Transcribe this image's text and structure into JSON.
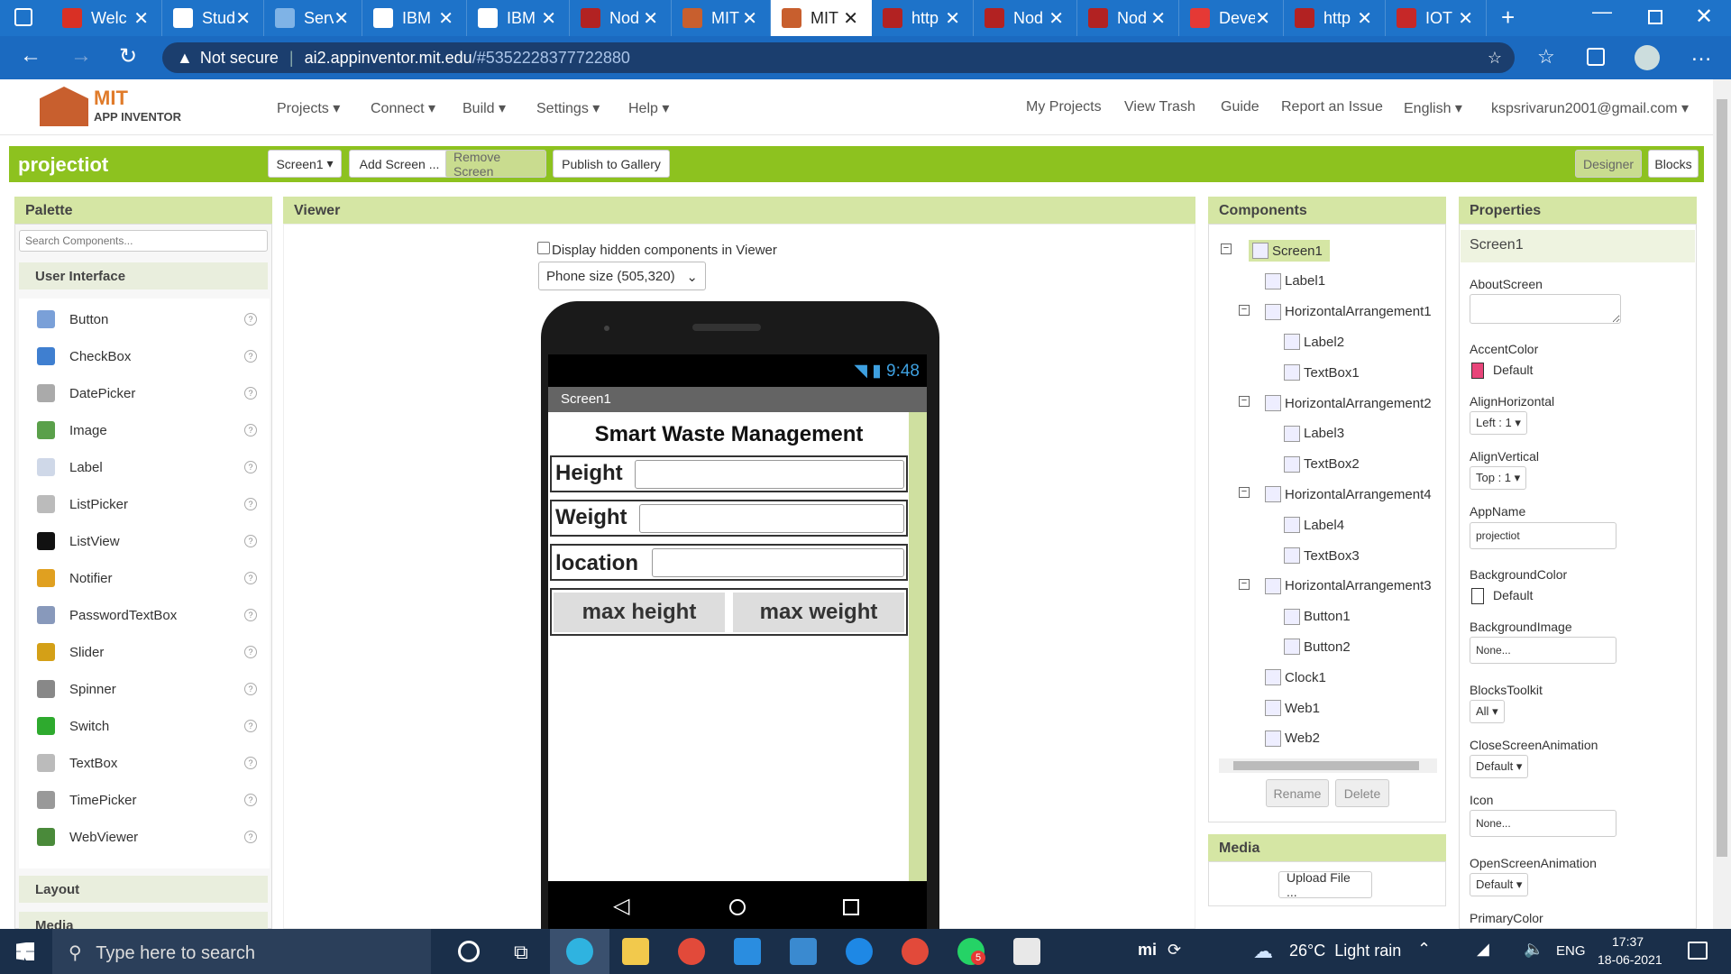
{
  "browser": {
    "tabs": [
      {
        "label": "Welc",
        "color": "#d93025"
      },
      {
        "label": "Stud",
        "color": "#ffffff"
      },
      {
        "label": "Serv",
        "color": "#7fb3e6"
      },
      {
        "label": "IBM",
        "color": "#ffffff"
      },
      {
        "label": "IBM",
        "color": "#ffffff"
      },
      {
        "label": "Nod",
        "color": "#b22222"
      },
      {
        "label": "MIT",
        "color": "#c85f2e"
      },
      {
        "label": "MIT",
        "color": "#c85f2e"
      },
      {
        "label": "http",
        "color": "#b22222"
      },
      {
        "label": "Nod",
        "color": "#b22222"
      },
      {
        "label": "Nod",
        "color": "#b22222"
      },
      {
        "label": "Deve",
        "color": "#e53935"
      },
      {
        "label": "http",
        "color": "#b22222"
      },
      {
        "label": "IOT",
        "color": "#c62828"
      }
    ],
    "active_tab_index": 7,
    "security_label": "Not secure",
    "url_host": "ai2.appinventor.mit.edu",
    "url_path": "/#5352228377722880"
  },
  "app": {
    "logo_line1": "MIT",
    "logo_line2": "APP INVENTOR",
    "menu": [
      "Projects",
      "Connect",
      "Build",
      "Settings",
      "Help"
    ],
    "right_links": [
      "My Projects",
      "View Trash",
      "Guide",
      "Report an Issue"
    ],
    "language": "English",
    "account": "kspsrivarun2001@gmail.com",
    "project_name": "projectiot",
    "screen_select": "Screen1",
    "add_screen": "Add Screen ...",
    "remove_screen": "Remove Screen",
    "publish": "Publish to Gallery",
    "designer": "Designer",
    "blocks": "Blocks"
  },
  "palette": {
    "title": "Palette",
    "search_placeholder": "Search Components...",
    "category": "User Interface",
    "items": [
      {
        "label": "Button",
        "icon": "button-icon",
        "color": "#7aa0d8"
      },
      {
        "label": "CheckBox",
        "icon": "checkbox-icon",
        "color": "#3f7fd0"
      },
      {
        "label": "DatePicker",
        "icon": "calendar-icon",
        "color": "#aaaaaa"
      },
      {
        "label": "Image",
        "icon": "image-icon",
        "color": "#5aa04a"
      },
      {
        "label": "Label",
        "icon": "label-icon",
        "color": "#cfd8e8"
      },
      {
        "label": "ListPicker",
        "icon": "listpicker-icon",
        "color": "#bbbbbb"
      },
      {
        "label": "ListView",
        "icon": "listview-icon",
        "color": "#111111"
      },
      {
        "label": "Notifier",
        "icon": "warning-icon",
        "color": "#e0a020"
      },
      {
        "label": "PasswordTextBox",
        "icon": "password-icon",
        "color": "#8899bb"
      },
      {
        "label": "Slider",
        "icon": "slider-icon",
        "color": "#d4a017"
      },
      {
        "label": "Spinner",
        "icon": "spinner-icon",
        "color": "#888888"
      },
      {
        "label": "Switch",
        "icon": "switch-icon",
        "color": "#2eaa2e"
      },
      {
        "label": "TextBox",
        "icon": "textbox-icon",
        "color": "#bbbbbb"
      },
      {
        "label": "TimePicker",
        "icon": "clock-icon",
        "color": "#999999"
      },
      {
        "label": "WebViewer",
        "icon": "globe-icon",
        "color": "#4a8a3a"
      }
    ],
    "help_glyph": "?",
    "layout_label": "Layout",
    "media_label": "Media"
  },
  "viewer": {
    "title": "Viewer",
    "hidden_checkbox_label": "Display hidden components in Viewer",
    "phone_size": "Phone size (505,320)",
    "status_time": "9:48",
    "screen_title": "Screen1",
    "app_title": "Smart Waste Management",
    "rows": [
      {
        "label": "Height"
      },
      {
        "label": "Weight"
      },
      {
        "label": "location"
      }
    ],
    "button1": "max height",
    "button2": "max weight"
  },
  "components": {
    "title": "Components",
    "tree": [
      {
        "label": "Screen1",
        "level": 0,
        "toggle": true,
        "selected": true
      },
      {
        "label": "Label1",
        "level": 1,
        "toggle": false
      },
      {
        "label": "HorizontalArrangement1",
        "level": 1,
        "toggle": true
      },
      {
        "label": "Label2",
        "level": 2,
        "toggle": false
      },
      {
        "label": "TextBox1",
        "level": 2,
        "toggle": false
      },
      {
        "label": "HorizontalArrangement2",
        "level": 1,
        "toggle": true
      },
      {
        "label": "Label3",
        "level": 2,
        "toggle": false
      },
      {
        "label": "TextBox2",
        "level": 2,
        "toggle": false
      },
      {
        "label": "HorizontalArrangement4",
        "level": 1,
        "toggle": true
      },
      {
        "label": "Label4",
        "level": 2,
        "toggle": false
      },
      {
        "label": "TextBox3",
        "level": 2,
        "toggle": false
      },
      {
        "label": "HorizontalArrangement3",
        "level": 1,
        "toggle": true
      },
      {
        "label": "Button1",
        "level": 2,
        "toggle": false
      },
      {
        "label": "Button2",
        "level": 2,
        "toggle": false
      },
      {
        "label": "Clock1",
        "level": 1,
        "toggle": false
      },
      {
        "label": "Web1",
        "level": 1,
        "toggle": false
      },
      {
        "label": "Web2",
        "level": 1,
        "toggle": false
      }
    ],
    "rename": "Rename",
    "delete": "Delete"
  },
  "media": {
    "title": "Media",
    "upload": "Upload File ..."
  },
  "properties": {
    "title": "Properties",
    "component": "Screen1",
    "about_label": "AboutScreen",
    "accent_label": "AccentColor",
    "accent_value": "Default",
    "accent_color": "#e8457a",
    "alignh_label": "AlignHorizontal",
    "alignh_value": "Left : 1",
    "alignv_label": "AlignVertical",
    "alignv_value": "Top : 1",
    "appname_label": "AppName",
    "appname_value": "projectiot",
    "bgcolor_label": "BackgroundColor",
    "bgcolor_value": "Default",
    "bgimage_label": "BackgroundImage",
    "bgimage_value": "None...",
    "blocks_label": "BlocksToolkit",
    "blocks_value": "All",
    "close_label": "CloseScreenAnimation",
    "close_value": "Default",
    "icon_label": "Icon",
    "icon_value": "None...",
    "open_label": "OpenScreenAnimation",
    "open_value": "Default",
    "primary_label": "PrimaryColor"
  },
  "taskbar": {
    "search_placeholder": "Type here to search",
    "weather": "26°C  Light rain",
    "lang": "ENG",
    "time": "17:37",
    "date": "18-06-2021",
    "whatsapp_badge": "5"
  }
}
